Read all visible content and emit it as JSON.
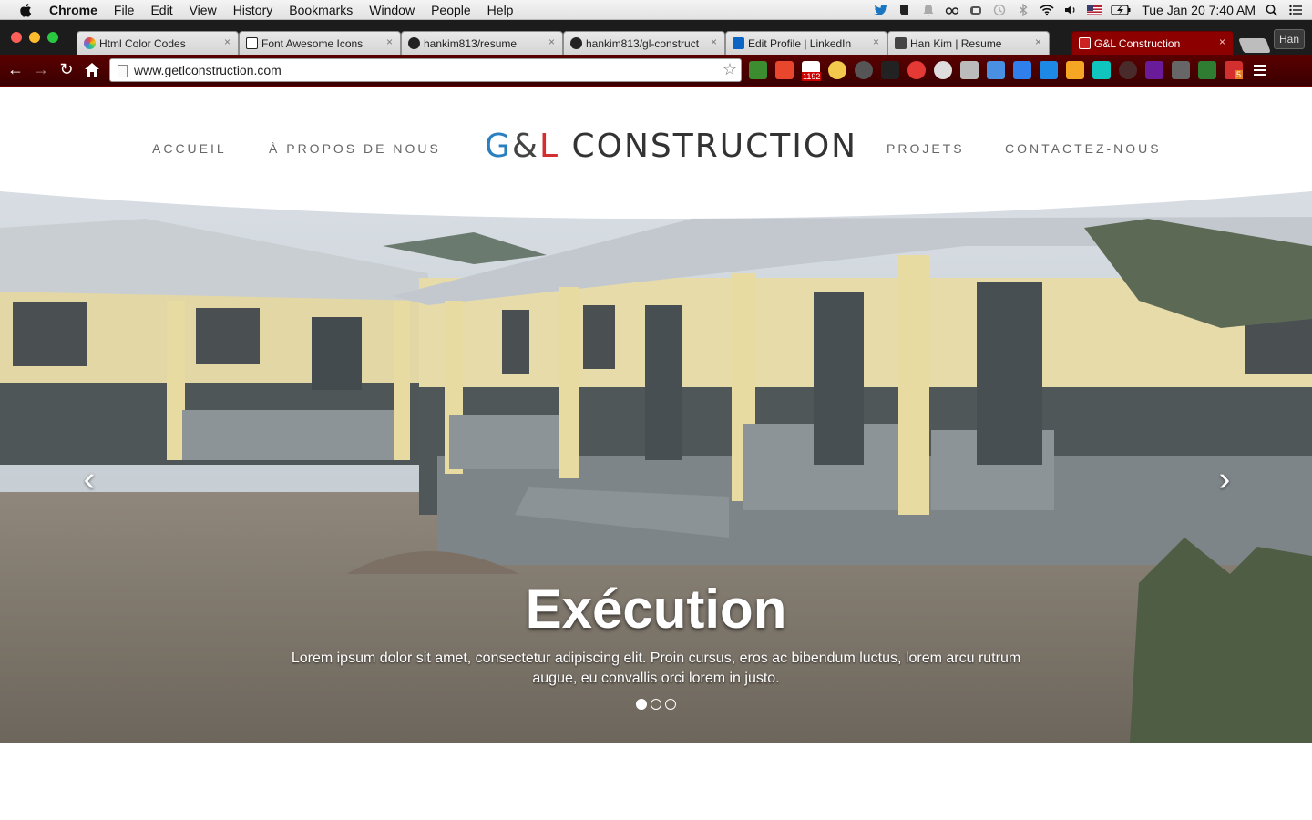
{
  "menubar": {
    "app_name": "Chrome",
    "items": [
      "File",
      "Edit",
      "View",
      "History",
      "Bookmarks",
      "Window",
      "People",
      "Help"
    ],
    "clock": "Tue Jan 20  7:40 AM",
    "status_icons": [
      "twitter-icon",
      "evernote-icon",
      "bell-icon",
      "glasses-icon",
      "lastpass-icon",
      "time-machine-icon",
      "bluetooth-icon",
      "wifi-icon",
      "volume-icon",
      "flag-us-icon",
      "battery-icon",
      "spotlight-icon",
      "notification-center-icon"
    ]
  },
  "browser": {
    "tabs": [
      {
        "label": "Html Color Codes",
        "favicon": "color-wheel-icon",
        "favicon_color": "#e74c3c"
      },
      {
        "label": "Font Awesome Icons",
        "favicon": "flag-icon",
        "favicon_color": "#222222"
      },
      {
        "label": "hankim813/resume",
        "favicon": "github-icon",
        "favicon_color": "#222222"
      },
      {
        "label": "hankim813/gl-construct",
        "favicon": "github-icon",
        "favicon_color": "#222222"
      },
      {
        "label": "Edit Profile | LinkedIn",
        "favicon": "linkedin-icon",
        "favicon_color": "#0a66c2"
      },
      {
        "label": "Han Kim | Resume",
        "favicon": "hk-icon",
        "favicon_color": "#444444"
      },
      {
        "label": "G&L Construction",
        "favicon": "gl-icon",
        "favicon_color": "#cc2222",
        "active": true
      }
    ],
    "tab_close_glyph": "×",
    "profile_label": "Han",
    "url": "www.getlconstruction.com",
    "gmail_badge": "1192",
    "extension_badge": "5"
  },
  "site": {
    "nav_left": [
      "Accueil",
      "À propos de nous"
    ],
    "nav_right": [
      "Projets",
      "Contactez-nous"
    ],
    "brand": {
      "g": "G",
      "amp": "&",
      "l": "L",
      "rest": " CONSTRUCTION"
    },
    "brand_colors": {
      "g": "#2a7fc0",
      "l": "#d32f2f",
      "rest": "#333333"
    }
  },
  "carousel": {
    "title": "Exécution",
    "text": "Lorem ipsum dolor sit amet, consectetur adipiscing elit. Proin cursus, eros ac bibendum luctus, lorem arcu rutrum augue, eu convallis orci lorem in justo.",
    "slide_count": 3,
    "active_index": 0,
    "prev_glyph": "‹",
    "next_glyph": "›"
  }
}
